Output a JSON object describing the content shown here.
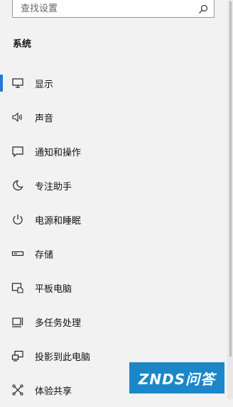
{
  "search": {
    "placeholder": "查找设置"
  },
  "section": {
    "title": "系统"
  },
  "nav": {
    "items": [
      {
        "label": "显示",
        "icon": "monitor-icon",
        "active": true
      },
      {
        "label": "声音",
        "icon": "speaker-icon"
      },
      {
        "label": "通知和操作",
        "icon": "notification-icon"
      },
      {
        "label": "专注助手",
        "icon": "moon-icon"
      },
      {
        "label": "电源和睡眠",
        "icon": "power-icon"
      },
      {
        "label": "存储",
        "icon": "storage-icon"
      },
      {
        "label": "平板电脑",
        "icon": "tablet-icon"
      },
      {
        "label": "多任务处理",
        "icon": "multitasking-icon"
      },
      {
        "label": "投影到此电脑",
        "icon": "projection-icon"
      },
      {
        "label": "体验共享",
        "icon": "shared-experiences-icon"
      }
    ]
  },
  "watermark": {
    "text": "ZNDS问答"
  },
  "colors": {
    "accent": "#1f7ad6",
    "watermark_bg": "#1b87c9",
    "background": "#f2f2f2"
  }
}
